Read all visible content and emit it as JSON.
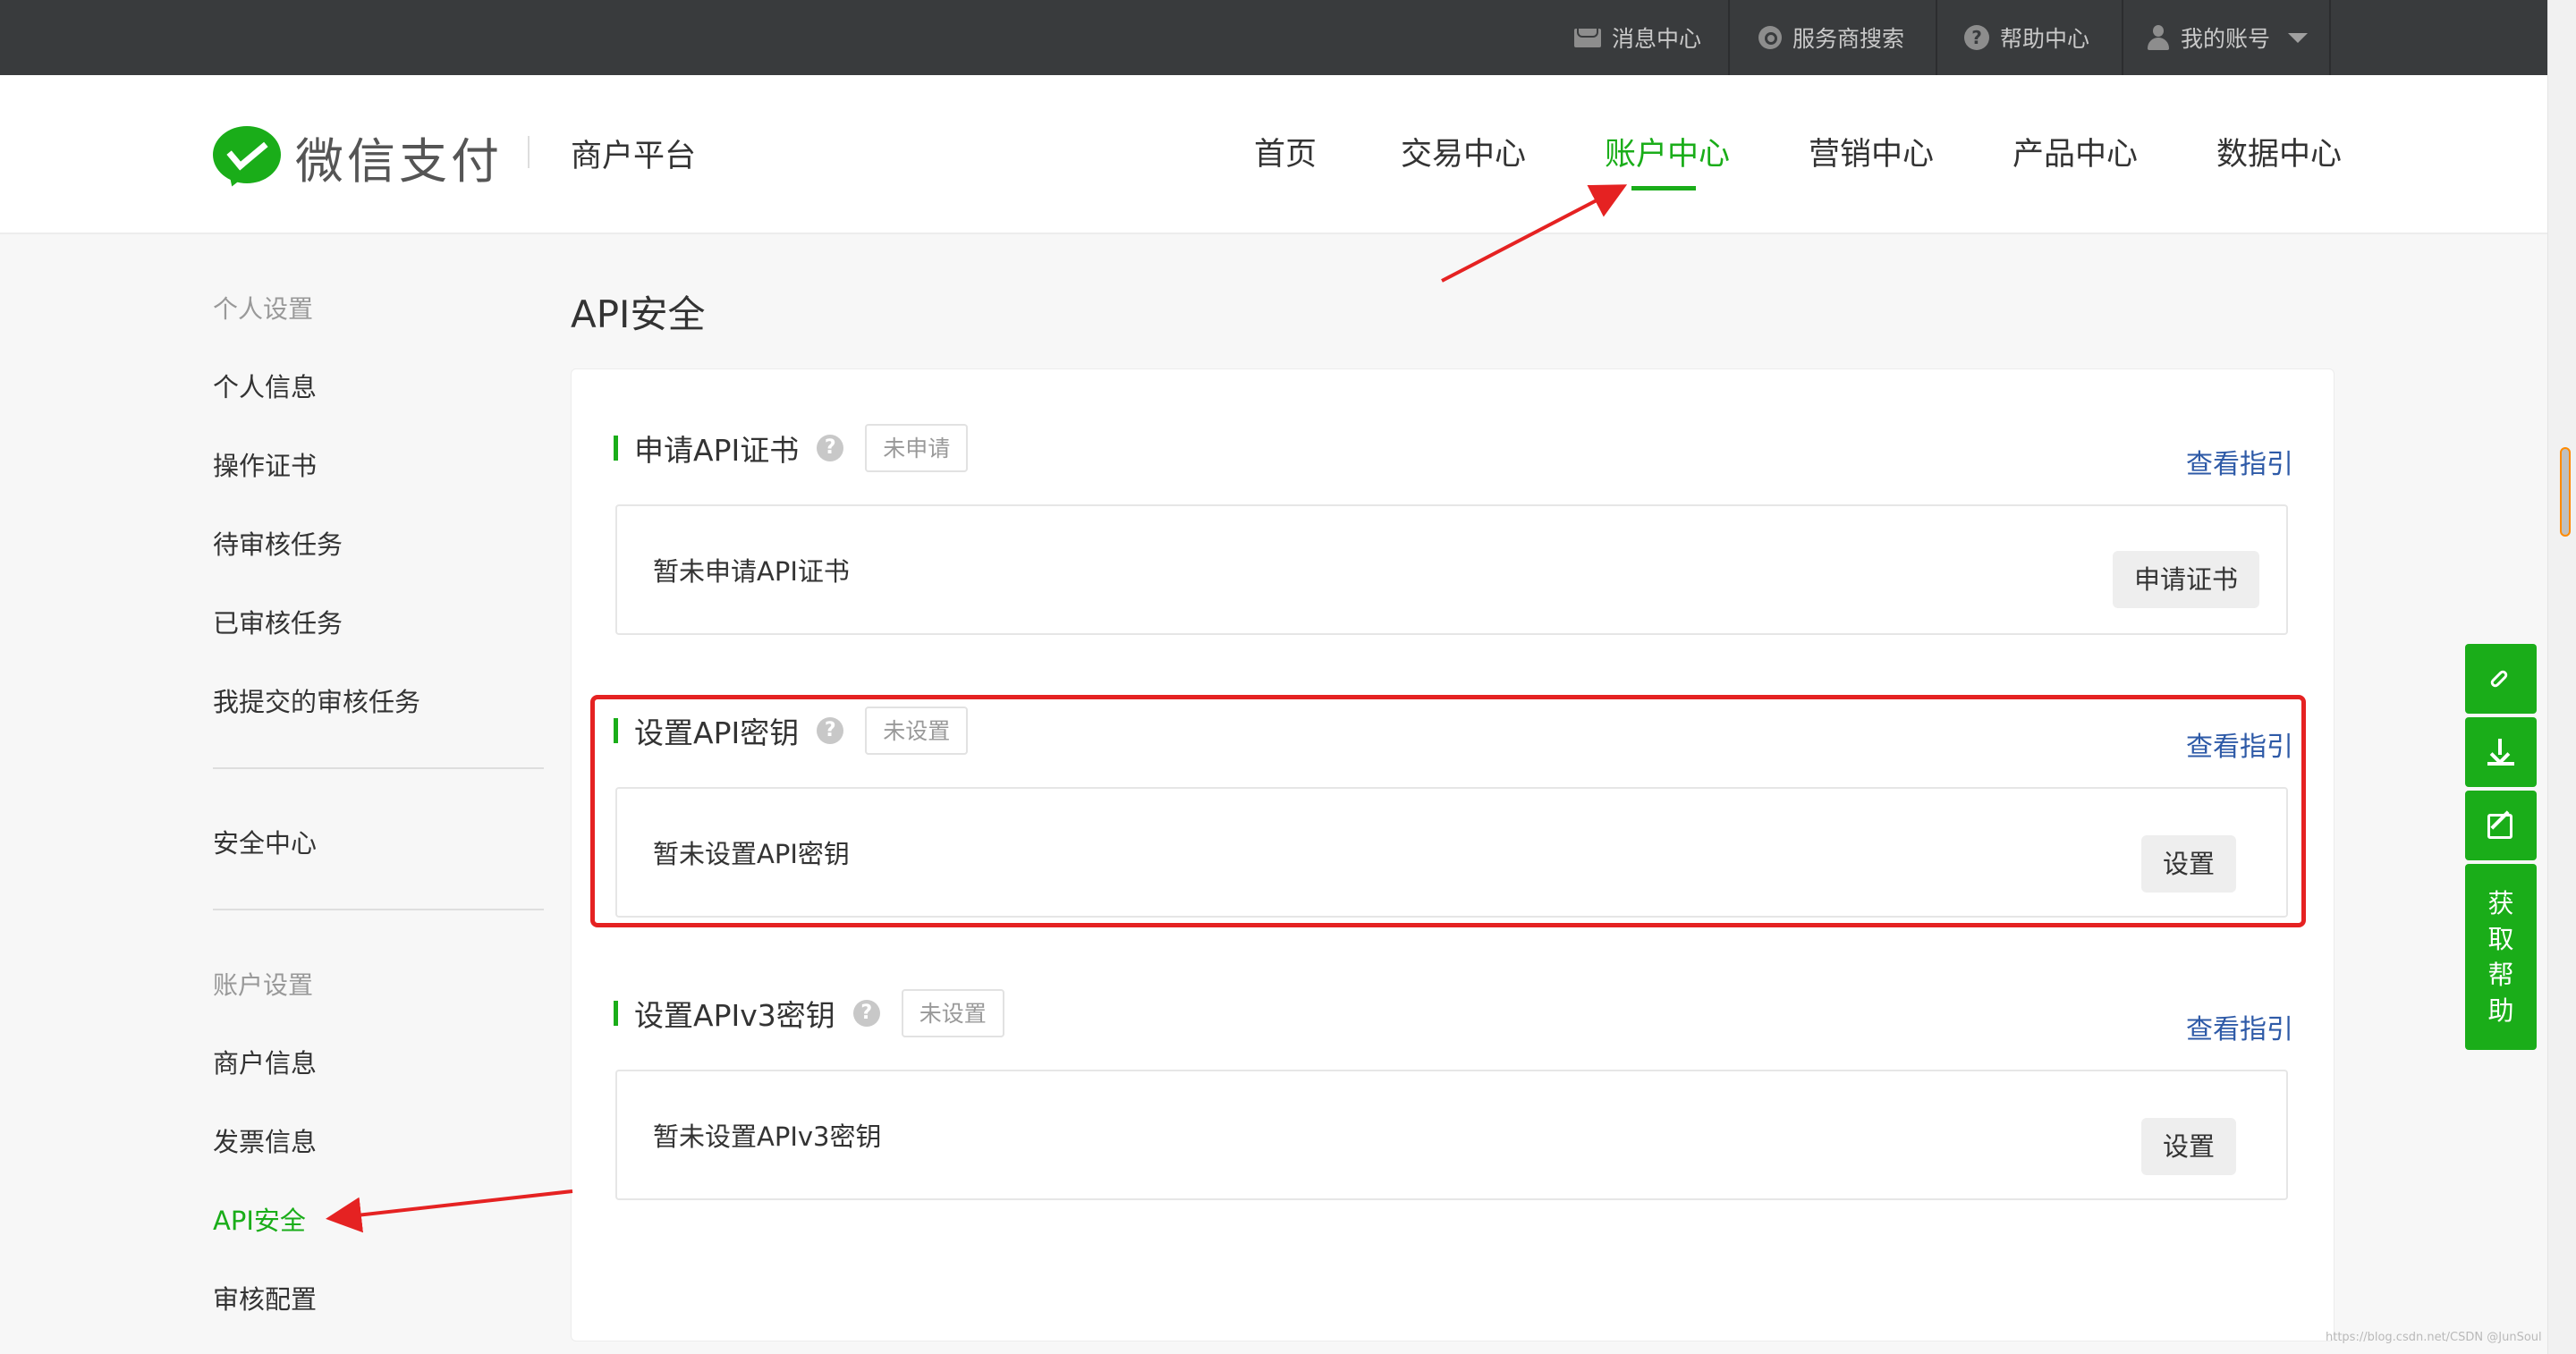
{
  "topbar": {
    "items": [
      {
        "label": "消息中心",
        "icon": "mail-icon"
      },
      {
        "label": "服务商搜索",
        "icon": "search-icon"
      },
      {
        "label": "帮助中心",
        "icon": "help-icon"
      },
      {
        "label": "我的账号",
        "icon": "user-icon"
      }
    ]
  },
  "header": {
    "logo_text": "微信支付",
    "subtitle": "商户平台",
    "nav": [
      {
        "label": "首页"
      },
      {
        "label": "交易中心"
      },
      {
        "label": "账户中心",
        "active": true
      },
      {
        "label": "营销中心"
      },
      {
        "label": "产品中心"
      },
      {
        "label": "数据中心"
      }
    ]
  },
  "sidebar": {
    "group1_title": "个人设置",
    "group1_items": [
      "个人信息",
      "操作证书",
      "待审核任务",
      "已审核任务",
      "我提交的审核任务"
    ],
    "security": "安全中心",
    "group2_title": "账户设置",
    "group2_items": [
      "商户信息",
      "发票信息",
      "API安全",
      "审核配置"
    ],
    "active_item": "API安全"
  },
  "main": {
    "page_title": "API安全",
    "sections": [
      {
        "title": "申请API证书",
        "status": "未申请",
        "guide": "查看指引",
        "box_text": "暂未申请API证书",
        "button": "申请证书"
      },
      {
        "title": "设置API密钥",
        "status": "未设置",
        "guide": "查看指引",
        "box_text": "暂未设置API密钥",
        "button": "设置"
      },
      {
        "title": "设置APIv3密钥",
        "status": "未设置",
        "guide": "查看指引",
        "box_text": "暂未设置APIv3密钥",
        "button": "设置"
      }
    ]
  },
  "float_panel": {
    "help_text": "获取帮助",
    "icons": [
      "link-icon",
      "download-icon",
      "edit-icon"
    ]
  },
  "watermark": "https://blog.csdn.net/CSDN @JunSoul",
  "colors": {
    "accent": "#1aad19",
    "link": "#2e5aa7",
    "topbar": "#393b3d",
    "highlight": "#e52222"
  }
}
